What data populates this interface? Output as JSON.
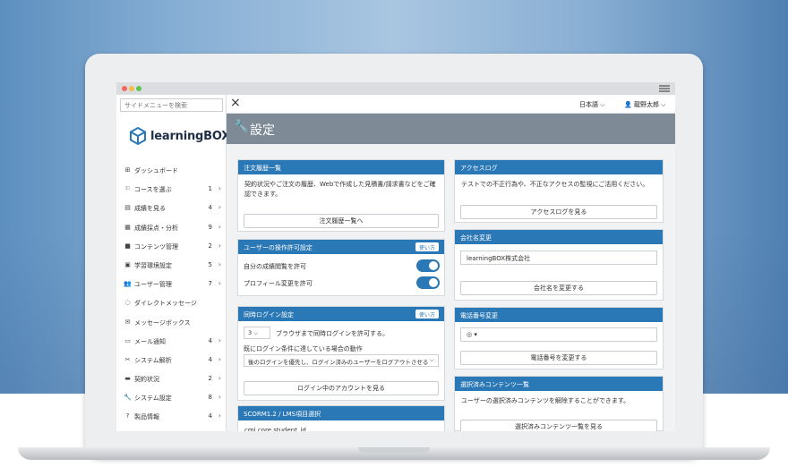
{
  "sidebar": {
    "search_placeholder": "サイドメニューを検索",
    "logo_text": "learningBOX",
    "items": [
      {
        "icon": "⊞",
        "label": "ダッシュボード",
        "count": "",
        "arrow": ""
      },
      {
        "icon": "⚐",
        "label": "コースを選ぶ",
        "count": "1",
        "arrow": "›"
      },
      {
        "icon": "▤",
        "label": "成績を見る",
        "count": "4",
        "arrow": "›"
      },
      {
        "icon": "▦",
        "label": "成績採点・分析",
        "count": "9",
        "arrow": "›"
      },
      {
        "icon": "■",
        "label": "コンテンツ管理",
        "count": "2",
        "arrow": "›"
      },
      {
        "icon": "▣",
        "label": "学習環境設定",
        "count": "5",
        "arrow": "›"
      },
      {
        "icon": "👥",
        "label": "ユーザー管理",
        "count": "7",
        "arrow": "›"
      },
      {
        "icon": "◌",
        "label": "ダイレクトメッセージ",
        "count": "",
        "arrow": ""
      },
      {
        "icon": "✉",
        "label": "メッセージボックス",
        "count": "",
        "arrow": ""
      },
      {
        "icon": "▭",
        "label": "メール通知",
        "count": "4",
        "arrow": "›"
      },
      {
        "icon": "✂",
        "label": "システム解析",
        "count": "4",
        "arrow": "›"
      },
      {
        "icon": "▬",
        "label": "契約状況",
        "count": "2",
        "arrow": "›"
      },
      {
        "icon": "🔧",
        "label": "システム設定",
        "count": "8",
        "arrow": "›"
      },
      {
        "icon": "?",
        "label": "製品情報",
        "count": "4",
        "arrow": "›"
      },
      {
        "icon": "",
        "label": "",
        "count": "",
        "arrow": ""
      }
    ]
  },
  "topbar": {
    "close_icon": "×",
    "language": "日本語 ⌵",
    "user": "👤 龍野太郎 ⌵"
  },
  "header": {
    "title": "設定"
  },
  "cards": {
    "order_history": {
      "title": "注文履歴一覧",
      "text": "契約状況やご注文の履歴、Webで作成した見積書/請求書などをご確認できます。",
      "button": "注文履歴一覧へ"
    },
    "user_permission": {
      "title": "ユーザーの操作許可設定",
      "help": "使い方",
      "row1": "自分の成績閲覧を許可",
      "row2": "プロフィール変更を許可"
    },
    "concurrent_login": {
      "title": "同時ログイン設定",
      "help": "使い方",
      "select_value": "3",
      "select_suffix": "ブラウザまで同時ログインを許可する。",
      "condition_label": "既にログイン条件に達している場合の動作",
      "condition_value": "後のログインを優先し、ログイン済みのユーザーをログアウトさせる",
      "button": "ログイン中のアカウントを見る"
    },
    "scorm": {
      "title": "SCORM1.2 / LMS項目選択",
      "text": "cmi.core.student_id"
    },
    "access_log": {
      "title": "アクセスログ",
      "text": "テストでの不正行為や、不正なアクセスの監視にご活用ください。",
      "button": "アクセスログを見る"
    },
    "company_name": {
      "title": "会社名変更",
      "value": "learningBOX株式会社",
      "button": "会社名を変更する"
    },
    "phone": {
      "title": "電話番号変更",
      "value": "◎ ▾",
      "button": "電話番号を変更する"
    },
    "selected_content": {
      "title": "選択済みコンテンツ一覧",
      "text": "ユーザーの選択済みコンテンツを解除することができます。",
      "button": "選択済みコンテンツ一覧を見る"
    }
  },
  "colors": {
    "accent": "#2a78b5",
    "header_bg": "#7e8a95"
  }
}
